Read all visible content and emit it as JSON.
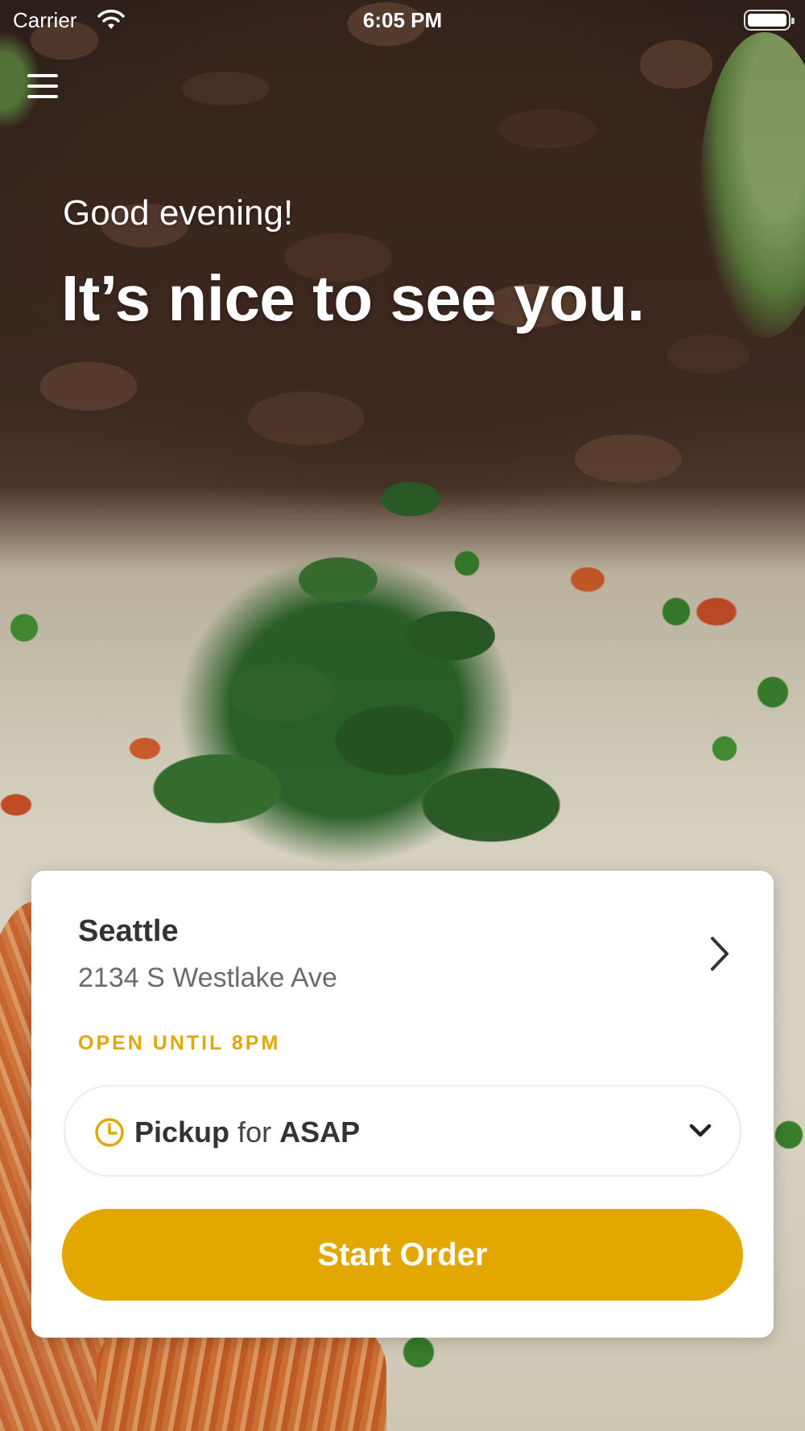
{
  "status_bar": {
    "carrier": "Carrier",
    "time": "6:05 PM",
    "battery_level": 1.0
  },
  "header": {
    "menu_icon": "hamburger-menu-icon"
  },
  "hero": {
    "greeting": "Good evening!",
    "headline": "It’s nice to see you.",
    "background_image": "beef-fried-rice-cilantro-photo"
  },
  "location_card": {
    "name": "Seattle",
    "address": "2134 S Westlake Ave",
    "hours": "OPEN UNTIL 8PM",
    "chevron_icon": "chevron-right-icon"
  },
  "order_type": {
    "mode": "Pickup",
    "connector": "for",
    "time": "ASAP",
    "icon": "clock-icon",
    "dropdown_icon": "chevron-down-icon"
  },
  "actions": {
    "start_order": "Start Order"
  },
  "colors": {
    "accent": "#E2A800",
    "hours_text": "#E0A800",
    "card_bg": "#FFFFFF",
    "title_text": "#333333",
    "secondary_text": "#6B6B6B"
  }
}
